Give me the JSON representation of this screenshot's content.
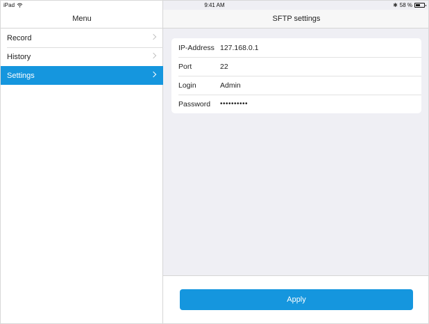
{
  "status_bar": {
    "device": "iPad",
    "time": "9:41 AM",
    "battery_text": "58 %",
    "battery_level": 0.58
  },
  "menu": {
    "title": "Menu",
    "items": [
      {
        "label": "Record",
        "active": false
      },
      {
        "label": "History",
        "active": false
      },
      {
        "label": "Settings",
        "active": true
      }
    ]
  },
  "detail": {
    "title": "SFTP settings",
    "fields": [
      {
        "label": "IP-Address",
        "value": "127.168.0.1"
      },
      {
        "label": "Port",
        "value": "22"
      },
      {
        "label": "Login",
        "value": "Admin"
      },
      {
        "label": "Password",
        "value": "••••••••••"
      }
    ],
    "apply_label": "Apply"
  },
  "colors": {
    "accent": "#1596de",
    "detail_background": "#efeff4"
  }
}
